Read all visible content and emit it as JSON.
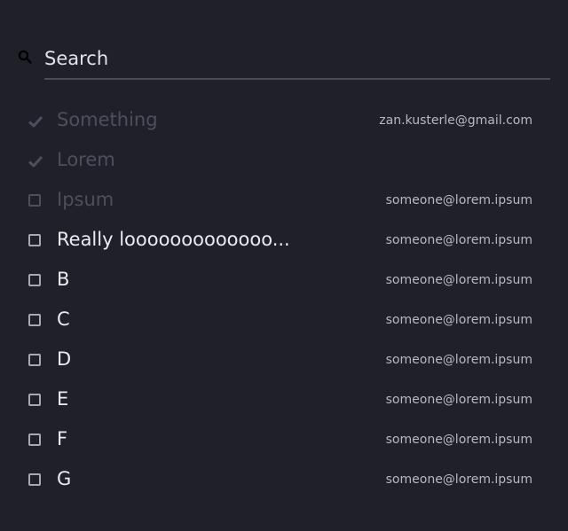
{
  "search": {
    "placeholder": "Search",
    "icon": "search-icon"
  },
  "items": [
    {
      "label": "Something",
      "email": "zan.kusterle@gmail.com",
      "state": "checked-disabled"
    },
    {
      "label": "Lorem",
      "email": "",
      "state": "checked-disabled"
    },
    {
      "label": "Ipsum",
      "email": "someone@lorem.ipsum",
      "state": "unchecked-disabled"
    },
    {
      "label": "Really looooooooooooo...",
      "email": "someone@lorem.ipsum",
      "state": "unchecked"
    },
    {
      "label": "B",
      "email": "someone@lorem.ipsum",
      "state": "unchecked"
    },
    {
      "label": "C",
      "email": "someone@lorem.ipsum",
      "state": "unchecked"
    },
    {
      "label": "D",
      "email": "someone@lorem.ipsum",
      "state": "unchecked"
    },
    {
      "label": "E",
      "email": "someone@lorem.ipsum",
      "state": "unchecked"
    },
    {
      "label": "F",
      "email": "someone@lorem.ipsum",
      "state": "unchecked"
    },
    {
      "label": "G",
      "email": "someone@lorem.ipsum",
      "state": "unchecked"
    }
  ],
  "colors": {
    "background": "#20202b",
    "text": "#eaeaf0",
    "disabled_text": "#4e4e5c",
    "email_text": "#b8b8c4"
  }
}
